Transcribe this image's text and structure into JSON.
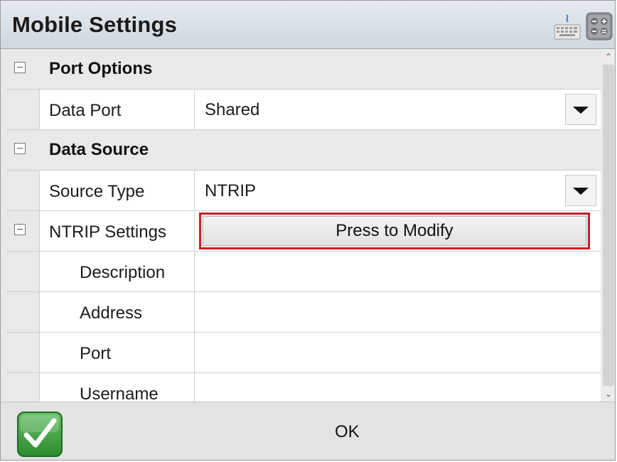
{
  "window": {
    "title": "Mobile Settings",
    "icons": [
      "keyboard-icon",
      "calculator-icon"
    ]
  },
  "grid": {
    "categories": {
      "port_options": "Port Options",
      "data_source": "Data Source"
    },
    "data_port": {
      "label": "Data Port",
      "value": "Shared"
    },
    "source_type": {
      "label": "Source Type",
      "value": "NTRIP"
    },
    "ntrip_settings": {
      "label": "NTRIP Settings",
      "button": "Press to Modify"
    },
    "fields": {
      "description": "Description",
      "address": "Address",
      "port": "Port",
      "username": "Username"
    }
  },
  "footer": {
    "ok_label": "OK"
  },
  "colors": {
    "highlight_border": "#c8202a",
    "ok_green": "#3aa03a"
  }
}
